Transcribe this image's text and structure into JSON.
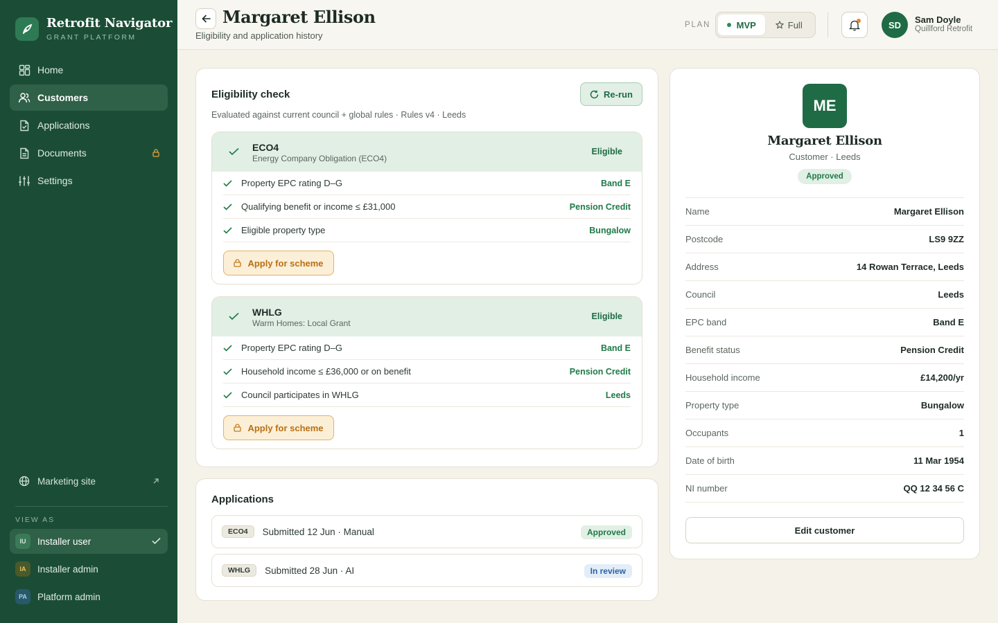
{
  "colors": {
    "sidebar": "#1b4d36",
    "accent": "#1f6b45",
    "eligible_bg": "#e1efe5",
    "warning": "#e3b062",
    "background": "#f5f2ea"
  },
  "brand": {
    "title": "Retrofit Navigator",
    "subtitle": "GRANT PLATFORM",
    "logo_icon": "leaf-icon"
  },
  "nav": [
    {
      "label": "Home",
      "icon": "home-icon"
    },
    {
      "label": "Customers",
      "icon": "users-icon",
      "active": true
    },
    {
      "label": "Applications",
      "icon": "file-check-icon"
    },
    {
      "label": "Documents",
      "icon": "document-icon",
      "locked": true
    },
    {
      "label": "Settings",
      "icon": "sliders-icon"
    }
  ],
  "marketing": {
    "label": "Marketing site"
  },
  "view_as": {
    "label": "VIEW AS",
    "roles": [
      {
        "initials": "IU",
        "label": "Installer user",
        "active": true
      },
      {
        "initials": "IA",
        "label": "Installer admin"
      },
      {
        "initials": "PA",
        "label": "Platform admin"
      }
    ]
  },
  "header": {
    "title": "Margaret Ellison",
    "subtitle": "Eligibility and application history",
    "plan_label": "PLAN",
    "plan_options": [
      "MVP",
      "Full"
    ],
    "plan_selected": "MVP",
    "user": {
      "initials": "SD",
      "name": "Sam Doyle",
      "org": "Quillford Retrofit"
    }
  },
  "eligibility": {
    "title": "Eligibility check",
    "rerun_label": "Re-run",
    "subtitle": "Evaluated against current council + global rules · Rules v4 · Leeds",
    "schemes": [
      {
        "name": "ECO4",
        "full_name": "Energy Company Obligation (ECO4)",
        "status": "Eligible",
        "criteria": [
          {
            "label": "Property EPC rating D–G",
            "value": "Band E"
          },
          {
            "label": "Qualifying benefit or income ≤ £31,000",
            "value": "Pension Credit"
          },
          {
            "label": "Eligible property type",
            "value": "Bungalow"
          }
        ],
        "apply_label": "Apply for scheme"
      },
      {
        "name": "WHLG",
        "full_name": "Warm Homes: Local Grant",
        "status": "Eligible",
        "criteria": [
          {
            "label": "Property EPC rating D–G",
            "value": "Band E"
          },
          {
            "label": "Household income ≤ £36,000 or on benefit",
            "value": "Pension Credit"
          },
          {
            "label": "Council participates in WHLG",
            "value": "Leeds"
          }
        ],
        "apply_label": "Apply for scheme"
      }
    ]
  },
  "applications": {
    "title": "Applications",
    "items": [
      {
        "scheme": "ECO4",
        "detail": "Submitted 12 Jun · Manual",
        "status": "Approved"
      },
      {
        "scheme": "WHLG",
        "detail": "Submitted 28 Jun · AI",
        "status": "In review"
      }
    ]
  },
  "profile": {
    "initials": "ME",
    "name": "Margaret Ellison",
    "role": "Customer · Leeds",
    "status": "Approved",
    "fields": [
      {
        "key": "Name",
        "value": "Margaret Ellison"
      },
      {
        "key": "Postcode",
        "value": "LS9 9ZZ"
      },
      {
        "key": "Address",
        "value": "14 Rowan Terrace, Leeds"
      },
      {
        "key": "Council",
        "value": "Leeds"
      },
      {
        "key": "EPC band",
        "value": "Band E"
      },
      {
        "key": "Benefit status",
        "value": "Pension Credit"
      },
      {
        "key": "Household income",
        "value": "£14,200/yr"
      },
      {
        "key": "Property type",
        "value": "Bungalow"
      },
      {
        "key": "Occupants",
        "value": "1"
      },
      {
        "key": "Date of birth",
        "value": "11 Mar 1954"
      },
      {
        "key": "NI number",
        "value": "QQ 12 34 56 C"
      }
    ],
    "edit_label": "Edit customer"
  }
}
